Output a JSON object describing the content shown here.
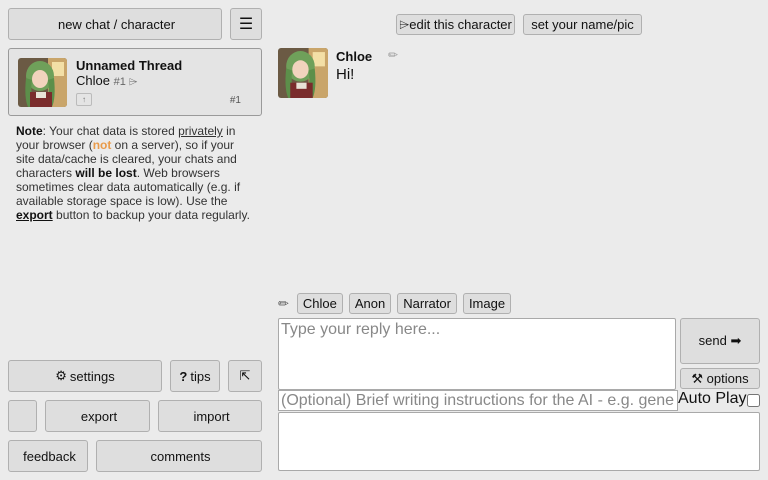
{
  "sidebar": {
    "new_chat": {
      "icon": "chat-icon",
      "glyph": "",
      "label": "new chat / character"
    },
    "menu": {
      "icon": "hamburger-menu-icon",
      "glyph": "☰"
    },
    "thread": {
      "title": "Unnamed Thread",
      "character": "Chloe",
      "character_sub": "#1 ⌲",
      "upload_glyph": "↑",
      "count": "#1",
      "action_glyphs": [
        "",
        "",
        ""
      ]
    },
    "note": {
      "p1": "Note",
      "p2": ": Your chat data is stored ",
      "p3": "privately",
      "p4": " in your browser (",
      "p5": "not",
      "p6": " on a server), so if your site data/cache is cleared, your chats and characters ",
      "p7": "will be lost",
      "p8": ". Web browsers sometimes clear data automatically ",
      "p9": "",
      "p10": " (e.g. if available storage space is low). Use the ",
      "p11": "export",
      "p12": " button to backup your data regularly."
    },
    "buttons": {
      "settings": {
        "icon": "gear-icon",
        "glyph": "⚙",
        "label": "settings"
      },
      "tips": {
        "icon": "question-icon",
        "glyph": "?",
        "label": "tips"
      },
      "collapse": {
        "icon": "collapse-arrow-icon",
        "glyph": "⇱"
      },
      "blank": {
        "icon": "unknown-icon",
        "glyph": ""
      },
      "export": {
        "icon": "export-icon",
        "glyph": "",
        "label": "export"
      },
      "import": {
        "icon": "import-icon",
        "glyph": "",
        "label": "import"
      },
      "feedback": {
        "icon": "feedback-icon",
        "glyph": "",
        "label": "feedback"
      },
      "comments": {
        "icon": "comments-icon",
        "glyph": "",
        "label": "comments"
      }
    }
  },
  "chat": {
    "header": {
      "edit_character": "⌲edit this character",
      "set_name": " set your name/pic"
    },
    "message": {
      "name": "Chloe",
      "text": "Hi! ",
      "actions": [
        "✏",
        "",
        ""
      ]
    },
    "quick_bar": {
      "pencil": "✏",
      "chips": [
        " Chloe",
        " Anon",
        " Narrator",
        " Image"
      ]
    },
    "input": {
      "reply_placeholder": "Type your reply here...",
      "send": "send ➡",
      "options": "⚒ options",
      "instructions_placeholder": "(Optional) Brief writing instructions for the AI - e.g. general style, what should happen next, etc.",
      "autoplay_label": "Auto Play",
      "autoplay_checked": false
    }
  },
  "colors": {
    "background": "#ebebeb",
    "button": "#dedede",
    "accent_orange": "#e99b4a"
  }
}
